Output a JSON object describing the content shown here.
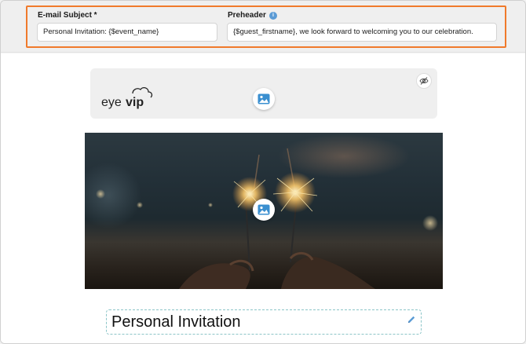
{
  "header": {
    "subject": {
      "label": "E-mail Subject *",
      "value": "Personal Invitation: {$event_name}"
    },
    "preheader": {
      "label": "Preheader",
      "info_icon": "info-icon",
      "value": "{$guest_firstname}, we look forward to welcoming you to our celebration."
    },
    "highlight_color": "#f07a2b"
  },
  "logo_block": {
    "logo_text_prefix": "eye",
    "logo_text_suffix": "vip",
    "visibility_icon": "eye-off-icon",
    "image_icon": "image-icon"
  },
  "hero": {
    "image_icon": "image-icon",
    "description_icon": "sparklers-photo"
  },
  "title_block": {
    "text": "Personal Invitation",
    "edit_icon": "pencil-icon"
  },
  "colors": {
    "accent_blue": "#5b9bd5",
    "title_border": "#8cc5c8",
    "highlight": "#f07a2b"
  }
}
